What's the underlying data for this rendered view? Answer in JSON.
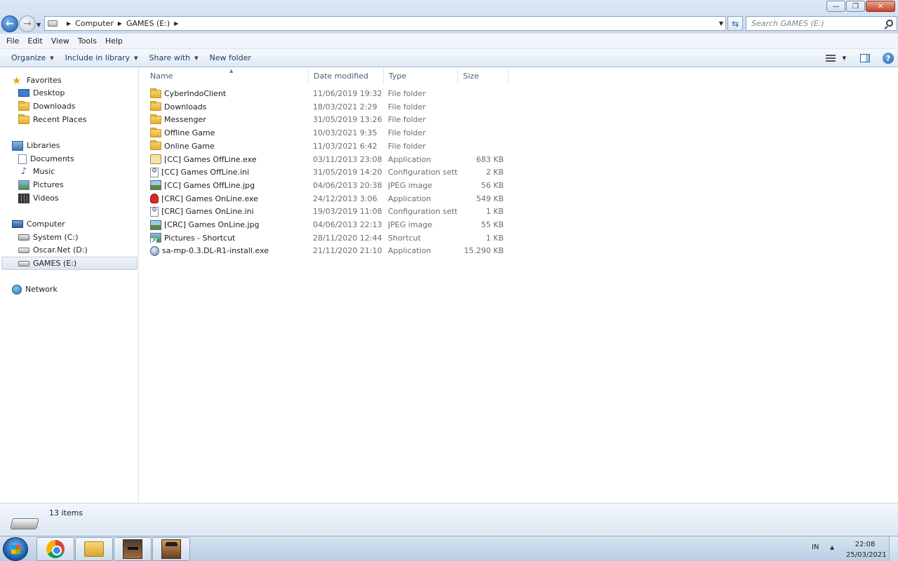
{
  "window": {
    "controls": {
      "minimize": "—",
      "maximize": "❐",
      "close": "✕"
    }
  },
  "address": {
    "crumbs": [
      "Computer",
      "GAMES (E:)"
    ]
  },
  "search": {
    "placeholder": "Search GAMES (E:)"
  },
  "menu": [
    "File",
    "Edit",
    "View",
    "Tools",
    "Help"
  ],
  "commands": {
    "organize": "Organize",
    "include_in_library": "Include in library",
    "share_with": "Share with",
    "new_folder": "New folder"
  },
  "nav": {
    "favorites": "Favorites",
    "desktop": "Desktop",
    "downloads": "Downloads",
    "recent_places": "Recent Places",
    "libraries": "Libraries",
    "documents": "Documents",
    "music": "Music",
    "pictures": "Pictures",
    "videos": "Videos",
    "computer": "Computer",
    "system_c": "System (C:)",
    "oscar_d": "Oscar.Net (D:)",
    "games_e": "GAMES (E:)",
    "network": "Network"
  },
  "columns": {
    "name": "Name",
    "date": "Date modified",
    "type": "Type",
    "size": "Size"
  },
  "files": [
    {
      "name": "CyberIndoClient",
      "date": "11/06/2019 19:32",
      "type": "File folder",
      "size": "",
      "icon": "folder-icon"
    },
    {
      "name": "Downloads",
      "date": "18/03/2021 2:29",
      "type": "File folder",
      "size": "",
      "icon": "folder-icon"
    },
    {
      "name": "Messenger",
      "date": "31/05/2019 13:26",
      "type": "File folder",
      "size": "",
      "icon": "folder-icon"
    },
    {
      "name": "Offline Game",
      "date": "10/03/2021 9:35",
      "type": "File folder",
      "size": "",
      "icon": "folder-icon"
    },
    {
      "name": "Online Game",
      "date": "11/03/2021 6:42",
      "type": "File folder",
      "size": "",
      "icon": "folder-icon"
    },
    {
      "name": "[CC] Games OffLine.exe",
      "date": "03/11/2013 23:08",
      "type": "Application",
      "size": "683 KB",
      "icon": "application-icon"
    },
    {
      "name": "[CC] Games OffLine.ini",
      "date": "31/05/2019 14:20",
      "type": "Configuration sett...",
      "size": "2 KB",
      "icon": "config-file-icon"
    },
    {
      "name": "[CC] Games OffLine.jpg",
      "date": "04/06/2013 20:38",
      "type": "JPEG image",
      "size": "56 KB",
      "icon": "image-file-icon"
    },
    {
      "name": "[CRC] Games OnLine.exe",
      "date": "24/12/2013 3:06",
      "type": "Application",
      "size": "549 KB",
      "icon": "application-icon"
    },
    {
      "name": "[CRC] Games OnLine.ini",
      "date": "19/03/2019 11:08",
      "type": "Configuration sett...",
      "size": "1 KB",
      "icon": "config-file-icon"
    },
    {
      "name": "[CRC] Games OnLine.jpg",
      "date": "04/06/2013 22:13",
      "type": "JPEG image",
      "size": "55 KB",
      "icon": "image-file-icon"
    },
    {
      "name": "Pictures - Shortcut",
      "date": "28/11/2020 12:44",
      "type": "Shortcut",
      "size": "1 KB",
      "icon": "shortcut-icon"
    },
    {
      "name": "sa-mp-0.3.DL-R1-install.exe",
      "date": "21/11/2020 21:10",
      "type": "Application",
      "size": "15.290 KB",
      "icon": "installer-icon"
    }
  ],
  "status": {
    "item_count": "13 items"
  },
  "taskbar": {
    "language": "IN",
    "time": "22:08",
    "date": "25/03/2021"
  }
}
